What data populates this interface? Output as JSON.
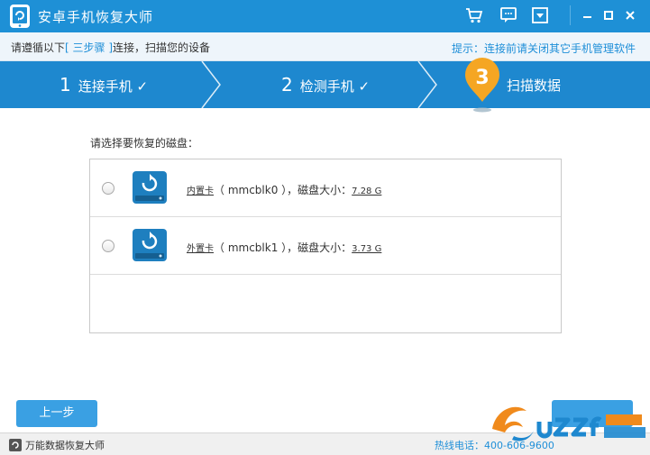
{
  "app": {
    "title": "安卓手机恢复大师"
  },
  "guide": {
    "prefix": "请遵循以下",
    "highlight": "[ 三步骤 ]",
    "suffix": "连接，扫描您的设备",
    "hint": "提示：连接前请关闭其它手机管理软件"
  },
  "steps": [
    {
      "num": "1",
      "label": "连接手机",
      "check": "✓"
    },
    {
      "num": "2",
      "label": "检测手机",
      "check": "✓"
    },
    {
      "num": "3",
      "label": "扫描数据"
    }
  ],
  "disk_prompt": "请选择要恢复的磁盘：",
  "disks": [
    {
      "name": "内置卡",
      "device": "（ mmcblk0 ），磁盘大小：",
      "size": "7.28 G"
    },
    {
      "name": "外置卡",
      "device": "（ mmcblk1 ），磁盘大小：",
      "size": "3.73 G"
    }
  ],
  "buttons": {
    "prev": "上一步"
  },
  "status": {
    "app_name": "万能数据恢复大师",
    "hotline": "热线电话：400-606-9600"
  },
  "icons": {
    "cart": "cart-icon",
    "feedback": "chat-icon",
    "menu": "dropdown-icon",
    "minimize": "minimize-icon",
    "maximize": "maximize-icon",
    "close": "close-icon"
  },
  "colors": {
    "brand": "#1e90d6",
    "step_bar": "#1e88cf",
    "active_step": "#f5a623"
  }
}
